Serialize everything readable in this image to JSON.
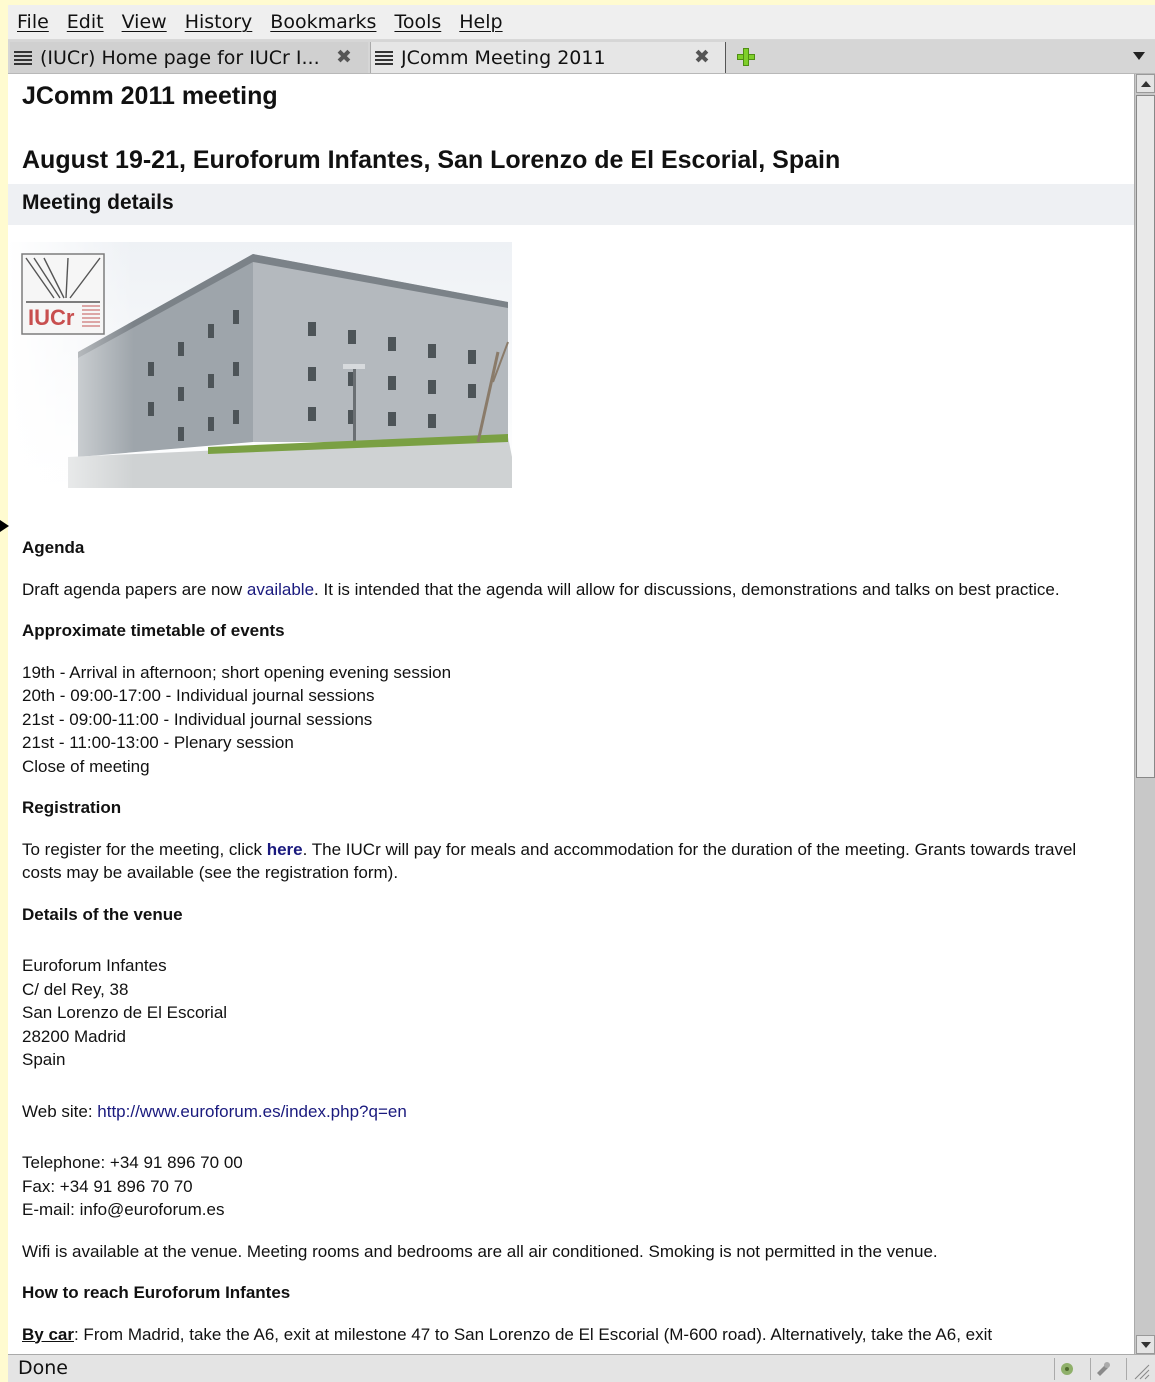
{
  "menus": [
    "File",
    "Edit",
    "View",
    "History",
    "Bookmarks",
    "Tools",
    "Help"
  ],
  "tabs": [
    {
      "title": "(IUCr) Home page for IUCr I..."
    },
    {
      "title": "JComm Meeting 2011"
    }
  ],
  "page": {
    "title": "JComm 2011 meeting",
    "subtitle": "August 19-21, Euroforum Infantes, San Lorenzo de El Escorial, Spain",
    "details_heading": "Meeting details",
    "logo_text": "IUCr",
    "agenda": {
      "heading": "Agenda",
      "text_before": "Draft agenda papers are now ",
      "link": "available",
      "text_after": ". It is intended that the agenda will allow for discussions, demonstrations and talks on best practice."
    },
    "timetable": {
      "heading": "Approximate timetable of events",
      "lines": [
        "19th - Arrival in afternoon; short opening evening session",
        "20th - 09:00-17:00 - Individual journal sessions",
        "21st - 09:00-11:00 - Individual journal sessions",
        "21st - 11:00-13:00 - Plenary session",
        "Close of meeting"
      ]
    },
    "registration": {
      "heading": "Registration",
      "text_before": "To register for the meeting, click ",
      "link": "here",
      "text_after": ". The IUCr will pay for meals and accommodation for the duration of the meeting. Grants towards travel costs may be available (see the registration form)."
    },
    "venue": {
      "heading": "Details of the venue",
      "address": [
        "Euroforum Infantes",
        "C/ del Rey, 38",
        "San Lorenzo de El Escorial",
        "28200 Madrid",
        "Spain"
      ],
      "website_label": "Web site: ",
      "website_url": "http://www.euroforum.es/index.php?q=en",
      "telephone": "Telephone: +34 91 896 70 00",
      "fax": "Fax: +34 91 896 70 70",
      "email": "E-mail: info@euroforum.es",
      "amenities": "Wifi is available at the venue. Meeting rooms and bedrooms are all air conditioned. Smoking is not permitted in the venue."
    },
    "reach": {
      "heading": "How to reach Euroforum Infantes",
      "by_car_label": "By car",
      "by_car_text": ": From Madrid, take the A6, exit at milestone 47 to San Lorenzo de El Escorial (M-600 road). Alternatively, take the A6, exit"
    }
  },
  "status": {
    "text": "Done"
  }
}
